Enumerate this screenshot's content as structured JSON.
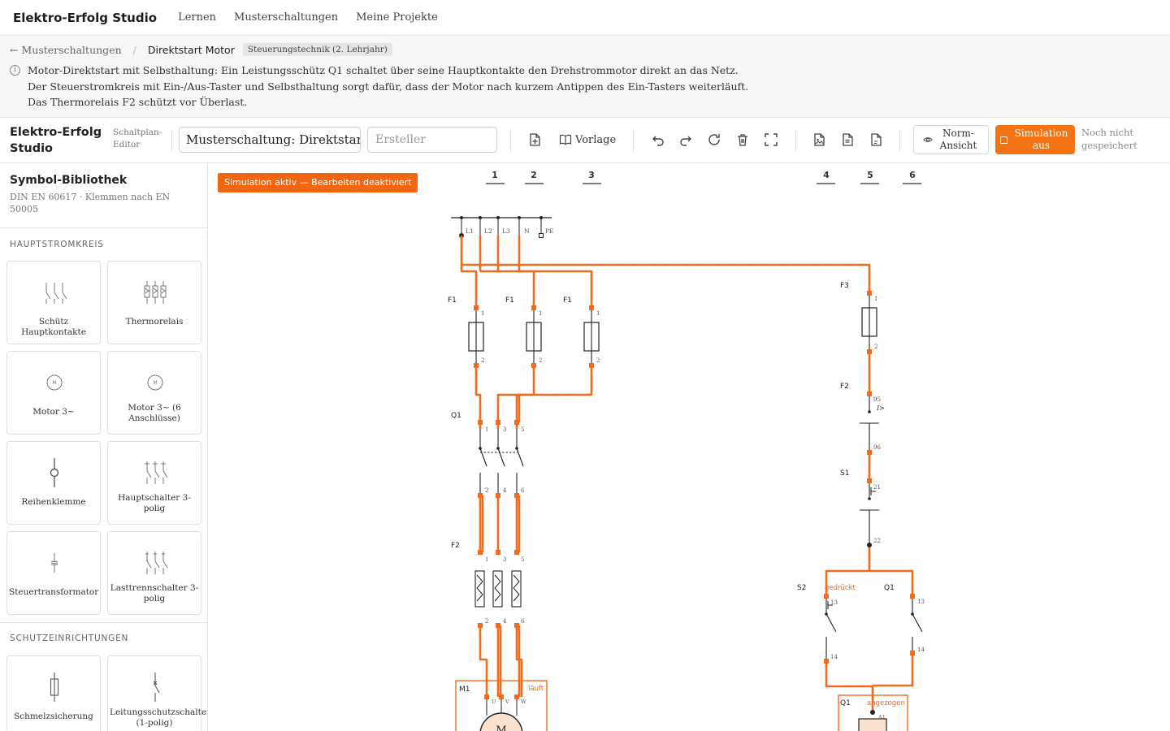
{
  "topnav": {
    "brand": "Elektro-Erfolg Studio",
    "links": [
      "Lernen",
      "Musterschaltungen",
      "Meine Projekte"
    ]
  },
  "header": {
    "back_label": "Musterschaltungen",
    "current": "Direktstart Motor",
    "tag": "Steuerungstechnik (2. Lehrjahr)",
    "info_lines": [
      "Motor-Direktstart mit Selbsthaltung: Ein Leistungsschütz Q1 schaltet über seine Hauptkontakte den Drehstrommotor direkt an das Netz.",
      "Der Steuerstromkreis mit Ein-/Aus-Taster und Selbsthaltung sorgt dafür, dass der Motor nach kurzem Antippen des Ein-Tasters weiterläuft.",
      "Das Thermorelais F2 schützt vor Überlast."
    ]
  },
  "toolbar": {
    "brand": "Elektro-Erfolg Studio",
    "sub": "Schaltplan-Editor",
    "title_value": "Musterschaltung: Direktstart Motor",
    "author_placeholder": "Ersteller",
    "vorlage_label": "Vorlage",
    "norm_label": "Norm-Ansicht",
    "sim_label": "Simulation aus",
    "save_status": "Noch nicht gespeichert"
  },
  "sidebar": {
    "title": "Symbol-Bibliothek",
    "subtitle": "DIN EN 60617 · Klemmen nach EN 50005",
    "section1": "HAUPTSTROMKREIS",
    "items1": [
      "Schütz Hauptkontakte",
      "Thermorelais",
      "Motor 3~",
      "Motor 3~ (6 Anschlüsse)",
      "Reihenklemme",
      "Hauptschalter 3-polig",
      "Steuertransformator",
      "Lasttrennschalter 3-polig"
    ],
    "section2": "SCHUTZEINRICHTUNGEN",
    "items2": [
      "Schmelzsicherung",
      "Leitungsschutzschalter (1-polig)"
    ]
  },
  "canvas": {
    "sim_banner": "Simulation aktiv — Bearbeiten deaktiviert",
    "columns": [
      "1",
      "2",
      "3",
      "4",
      "5",
      "6"
    ],
    "bus_labels": [
      "L1",
      "L2",
      "L3",
      "N",
      "PE"
    ],
    "components": {
      "f1": "F1",
      "q1": "Q1",
      "f2": "F2",
      "m1": "M1",
      "m_label": "M",
      "f3": "F3",
      "f2_ctrl": "F2",
      "s1": "S1",
      "s2": "S2",
      "q1_ctrl": "Q1",
      "q1_coil": "Q1"
    },
    "status": {
      "motor": "läuft",
      "s2": "gedrückt",
      "coil": "angezogen"
    },
    "terminals": {
      "fuse": [
        "1",
        "2"
      ],
      "q1_top": [
        "1",
        "3",
        "5"
      ],
      "q1_bot": [
        "2",
        "4",
        "6"
      ],
      "f2_top": [
        "1",
        "3",
        "5"
      ],
      "f2_bot": [
        "2",
        "4",
        "6"
      ],
      "motor": [
        "U",
        "V",
        "W"
      ],
      "f2_ctrl": [
        "95",
        "96"
      ],
      "f2_sym": "I>",
      "s1": [
        "21",
        "22"
      ],
      "s2": [
        "13",
        "14"
      ],
      "q1_ctrl": [
        "13",
        "14"
      ],
      "coil": "A1"
    },
    "colors": {
      "live": "#f26b1d",
      "wire": "#222222",
      "accent": "#f47315"
    }
  }
}
